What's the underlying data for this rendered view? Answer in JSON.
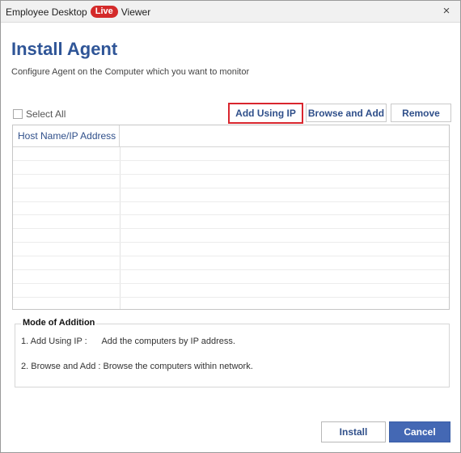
{
  "window": {
    "app_name": "Employee Desktop",
    "live_badge": "Live",
    "app_suffix": "Viewer",
    "close_symbol": "×"
  },
  "header": {
    "title": "Install Agent",
    "subtitle": "Configure Agent on the Computer which you want to monitor"
  },
  "toolbar": {
    "select_all_label": "Select All",
    "add_using_ip_label": "Add Using IP",
    "browse_and_add_label": "Browse and Add",
    "remove_label": "Remove"
  },
  "grid": {
    "columns": [
      "Host Name/IP Address",
      ""
    ],
    "rows": []
  },
  "mode_of_addition": {
    "title": "Mode of Addition",
    "line1": "1. Add Using IP :      Add the computers by IP address.",
    "line2": "2. Browse and Add : Browse the computers within network."
  },
  "footer": {
    "install_label": "Install",
    "cancel_label": "Cancel"
  },
  "colors": {
    "accent": "#2f5597",
    "live_badge": "#d42a2a",
    "highlight_border": "#d9262e",
    "primary_button": "#4468b4"
  },
  "icons": {
    "close": "close-icon",
    "checkbox": "checkbox-icon"
  }
}
